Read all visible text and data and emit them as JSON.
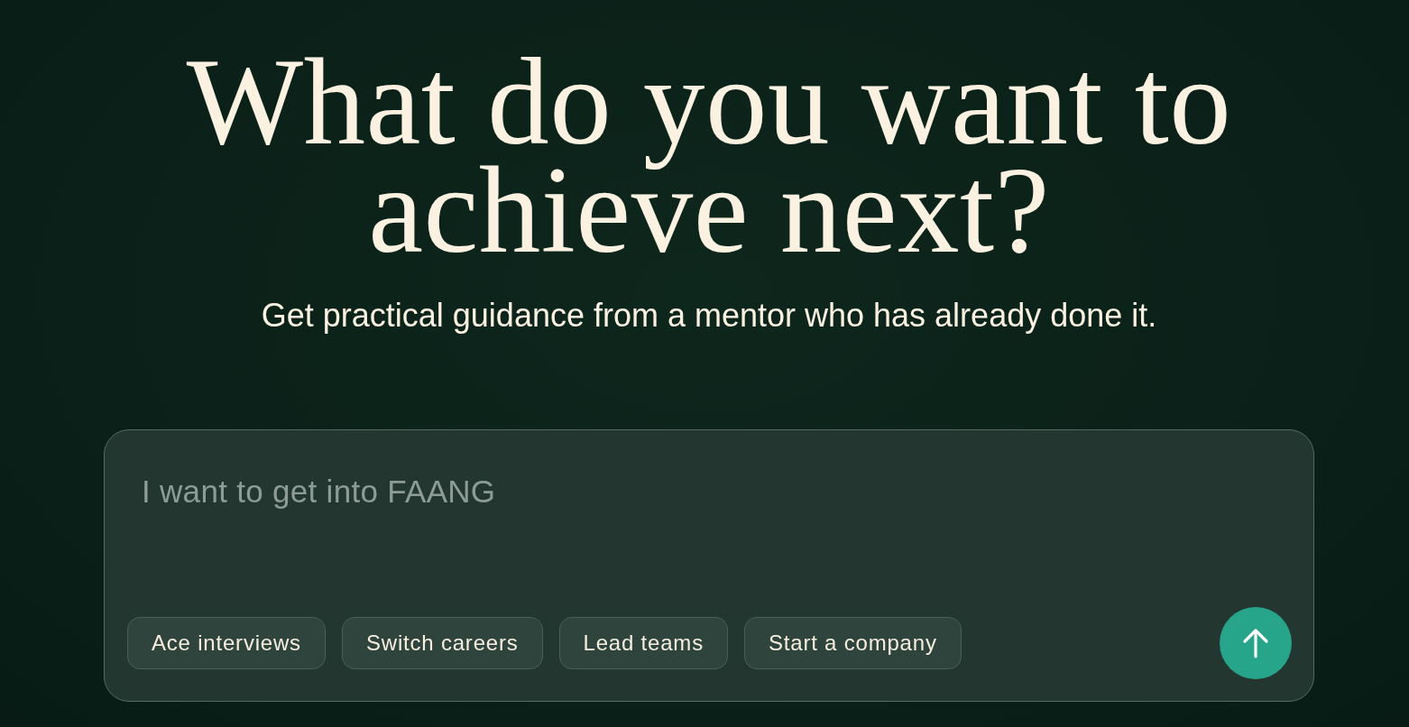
{
  "hero": {
    "title_lines": [
      "What do you want to",
      "achieve next?"
    ],
    "subtitle": "Get practical guidance from a mentor who has already done it."
  },
  "prompt_box": {
    "placeholder": "I want to get into FAANG",
    "suggestions": [
      {
        "label": "Ace interviews"
      },
      {
        "label": "Switch careers"
      },
      {
        "label": "Lead teams"
      },
      {
        "label": "Start a company"
      }
    ]
  }
}
